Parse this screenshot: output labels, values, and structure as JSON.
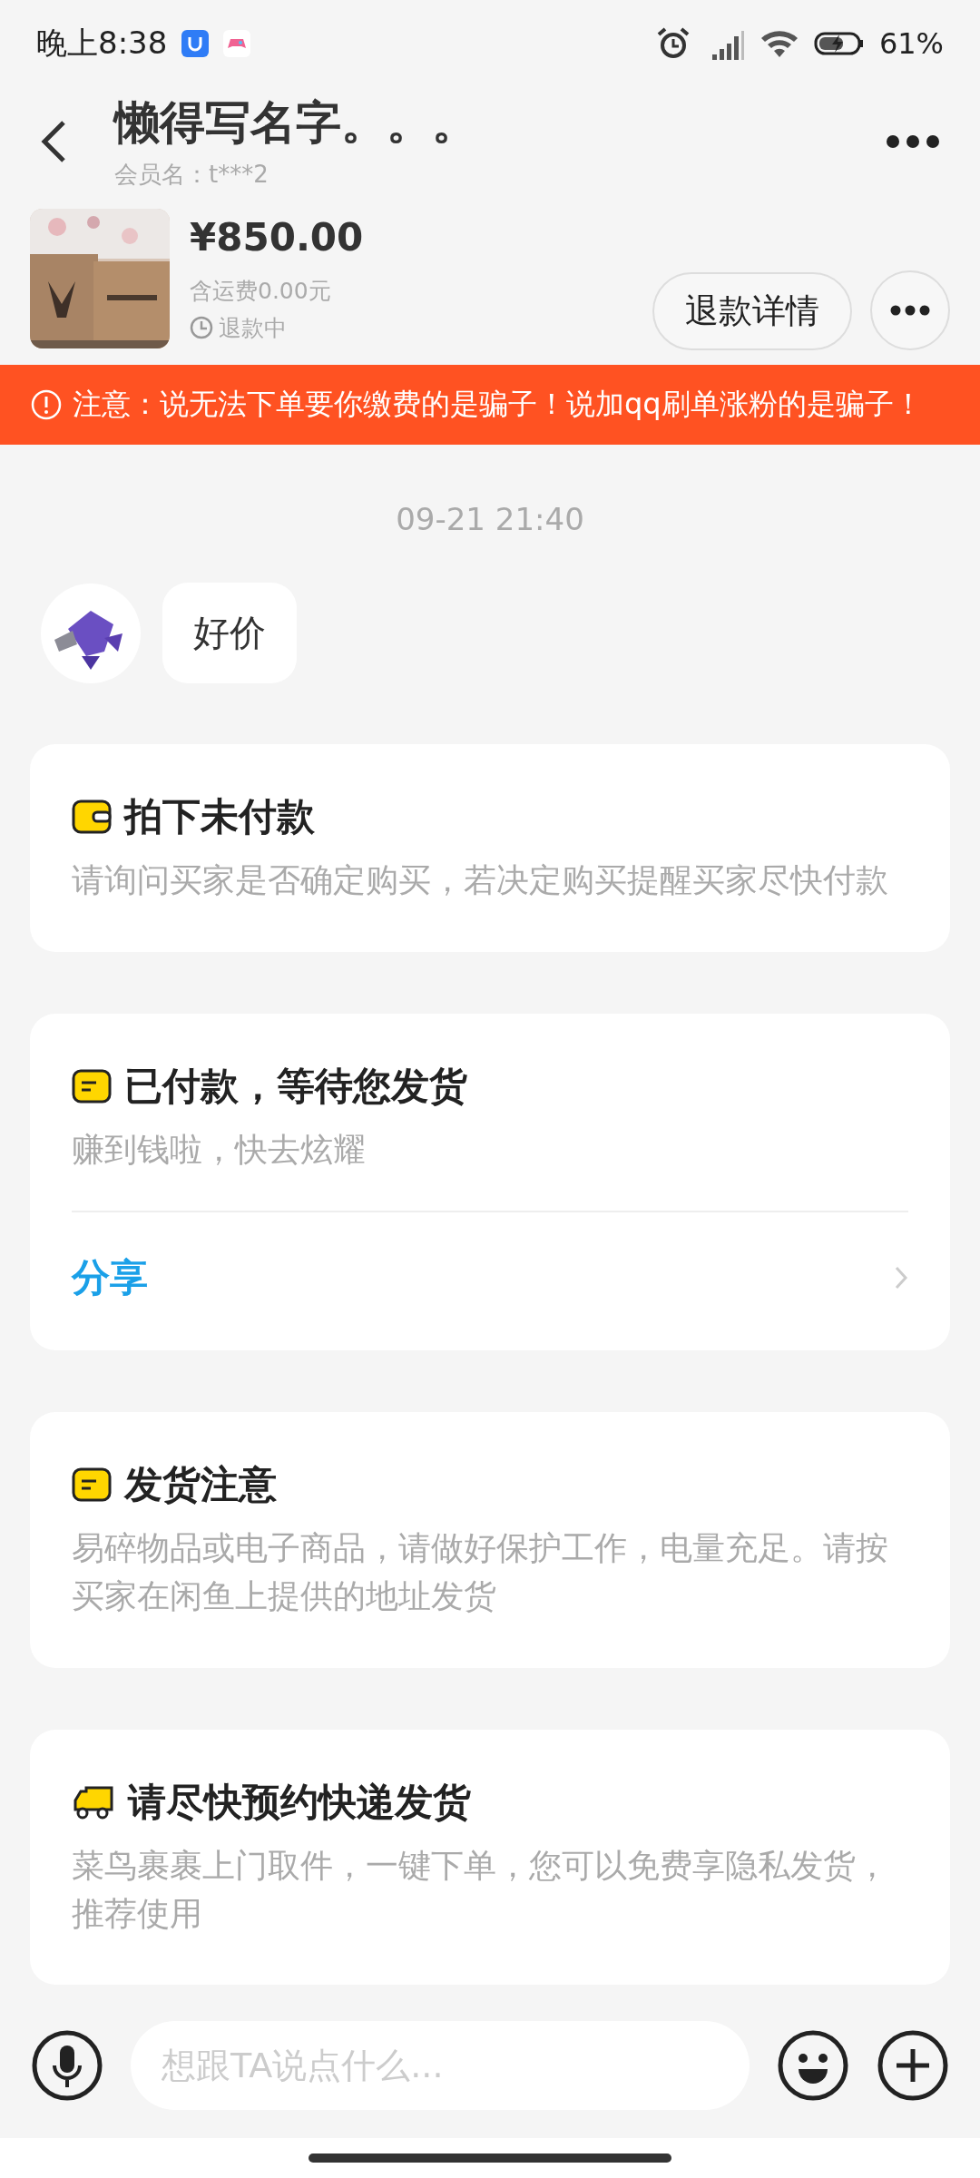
{
  "status_bar": {
    "time": "晚上8:38",
    "battery": "61%"
  },
  "header": {
    "title": "懒得写名字。。。",
    "subtitle": "会员名：t***2"
  },
  "order": {
    "price": "¥850.00",
    "shipping": "含运费0.00元",
    "status": "退款中",
    "action": "退款详情"
  },
  "notice": {
    "text": "注意：说无法下单要你缴费的是骗子！说加qq刷单涨粉的是骗子！"
  },
  "chat": {
    "timestamp": "09-21 21:40",
    "messages": [
      {
        "text": "好价"
      }
    ]
  },
  "cards": [
    {
      "kind": "wallet",
      "title": "拍下未付款",
      "body": "请询问买家是否确定购买，若决定购买提醒买家尽快付款"
    },
    {
      "kind": "list",
      "title": "已付款，等待您发货",
      "body": "赚到钱啦，快去炫耀",
      "link": "分享"
    },
    {
      "kind": "list",
      "title": "发货注意",
      "body": "易碎物品或电子商品，请做好保护工作，电量充足。请按买家在闲鱼上提供的地址发货"
    },
    {
      "kind": "truck",
      "title": "请尽快预约快递发货",
      "body": "菜鸟裹裹上门取件，一键下单，您可以免费享隐私发货，推荐使用"
    }
  ],
  "input": {
    "placeholder": "想跟TA说点什么..."
  }
}
